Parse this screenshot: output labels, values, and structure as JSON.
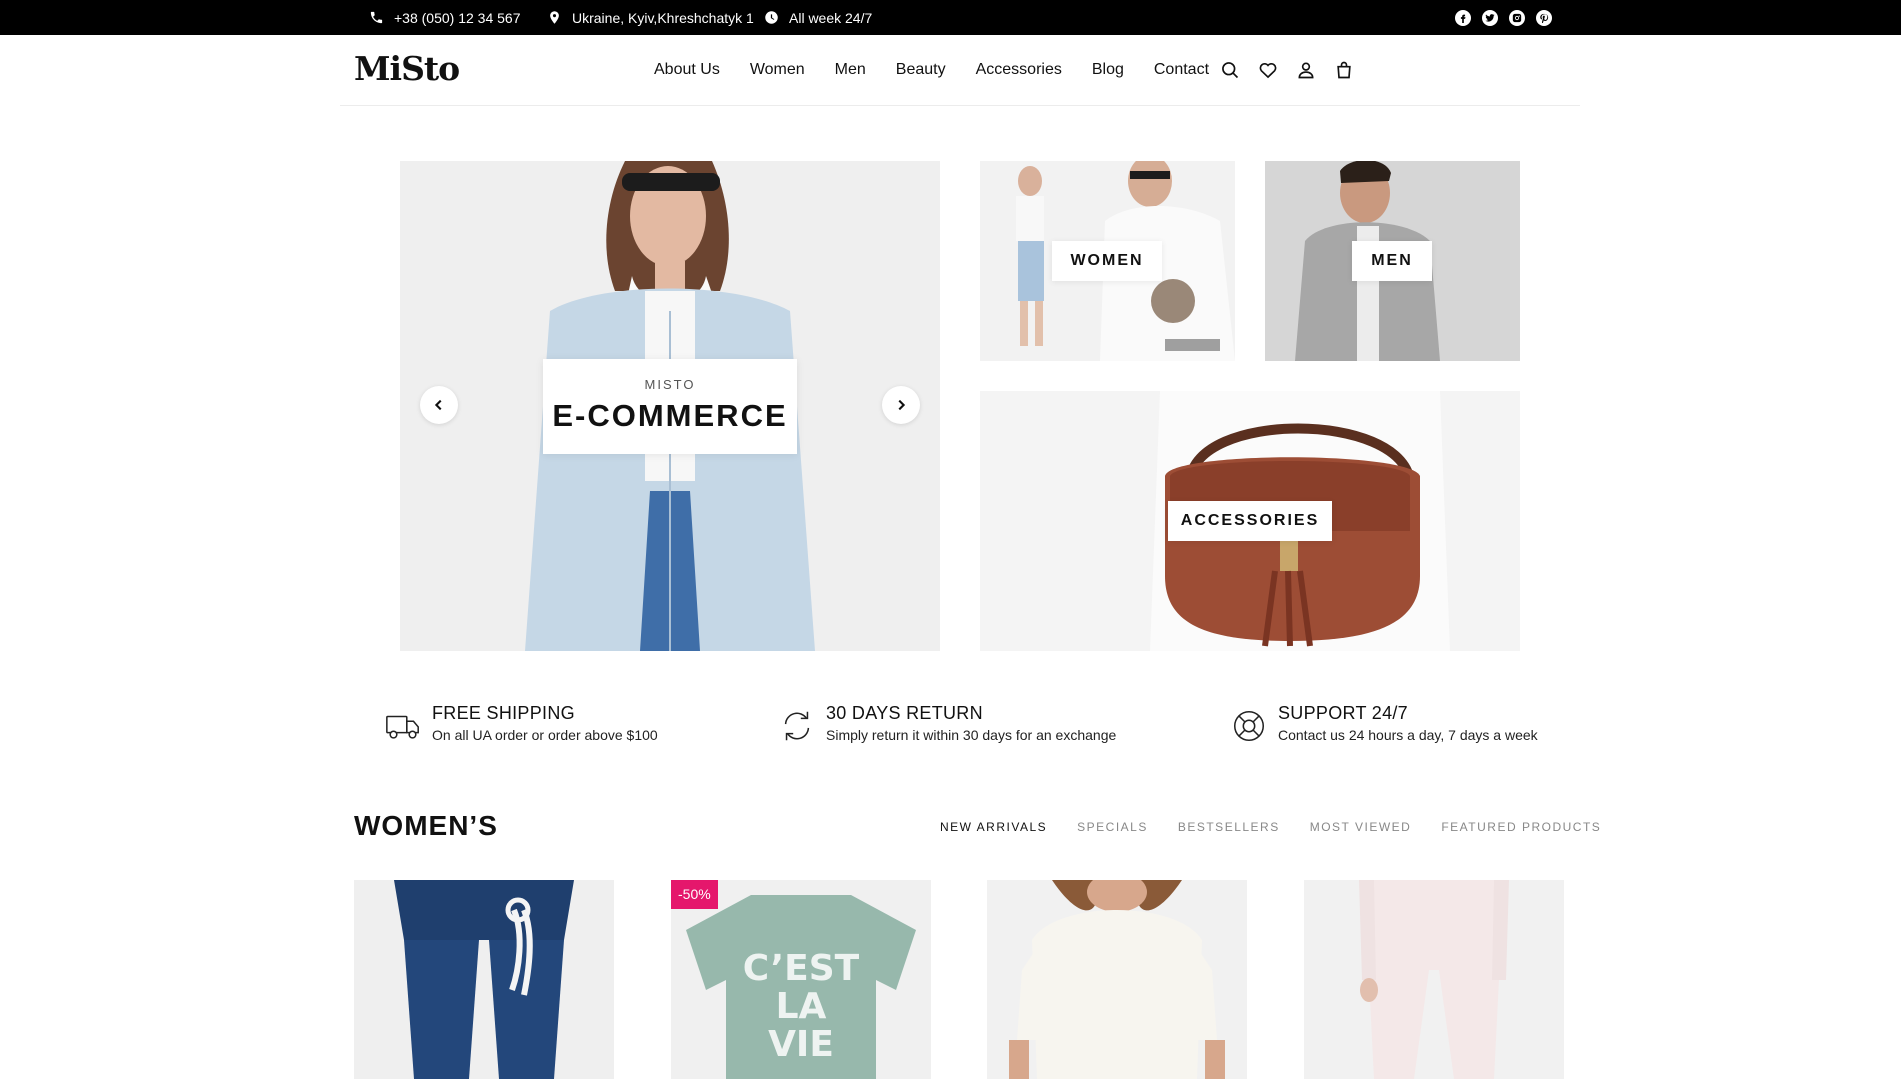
{
  "topbar": {
    "phone": "+38 (050) 12 34 567",
    "address": "Ukraine, Kyiv,Khreshchatyk 1",
    "hours": "All week 24/7",
    "social_icons": [
      "facebook-icon",
      "twitter-icon",
      "instagram-icon",
      "pinterest-icon"
    ]
  },
  "header": {
    "logo": "MiSto",
    "nav": [
      "About Us",
      "Women",
      "Men",
      "Beauty",
      "Accessories",
      "Blog",
      "Contact"
    ],
    "icons": [
      "search-icon",
      "heart-icon",
      "user-icon",
      "cart-icon"
    ]
  },
  "hero": {
    "subtitle": "MISTO",
    "title": "E-COMMERCE"
  },
  "categories": {
    "women": "WOMEN",
    "men": "MEN",
    "accessories": "ACCESSORIES"
  },
  "features": [
    {
      "title": "FREE SHIPPING",
      "desc": "On all UA order or order above $100",
      "icon": "truck-icon"
    },
    {
      "title": "30 DAYS RETURN",
      "desc": "Simply return it within 30 days for an exchange",
      "icon": "return-icon"
    },
    {
      "title": "SUPPORT 24/7",
      "desc": "Contact us 24 hours a day, 7 days a week",
      "icon": "support-icon"
    }
  ],
  "womens": {
    "title": "WOMEN’S",
    "tabs": [
      "NEW ARRIVALS",
      "SPECIALS",
      "BESTSELLERS",
      "MOST VIEWED",
      "FEATURED PRODUCTS"
    ],
    "active_tab": "NEW ARRIVALS",
    "sale_badge": "-50%",
    "shirt_text": [
      "C’EST",
      "LA",
      "VIE"
    ]
  },
  "colors": {
    "topbar_bg": "#000000",
    "sale_badge": "#e5176c",
    "text": "#111111"
  }
}
